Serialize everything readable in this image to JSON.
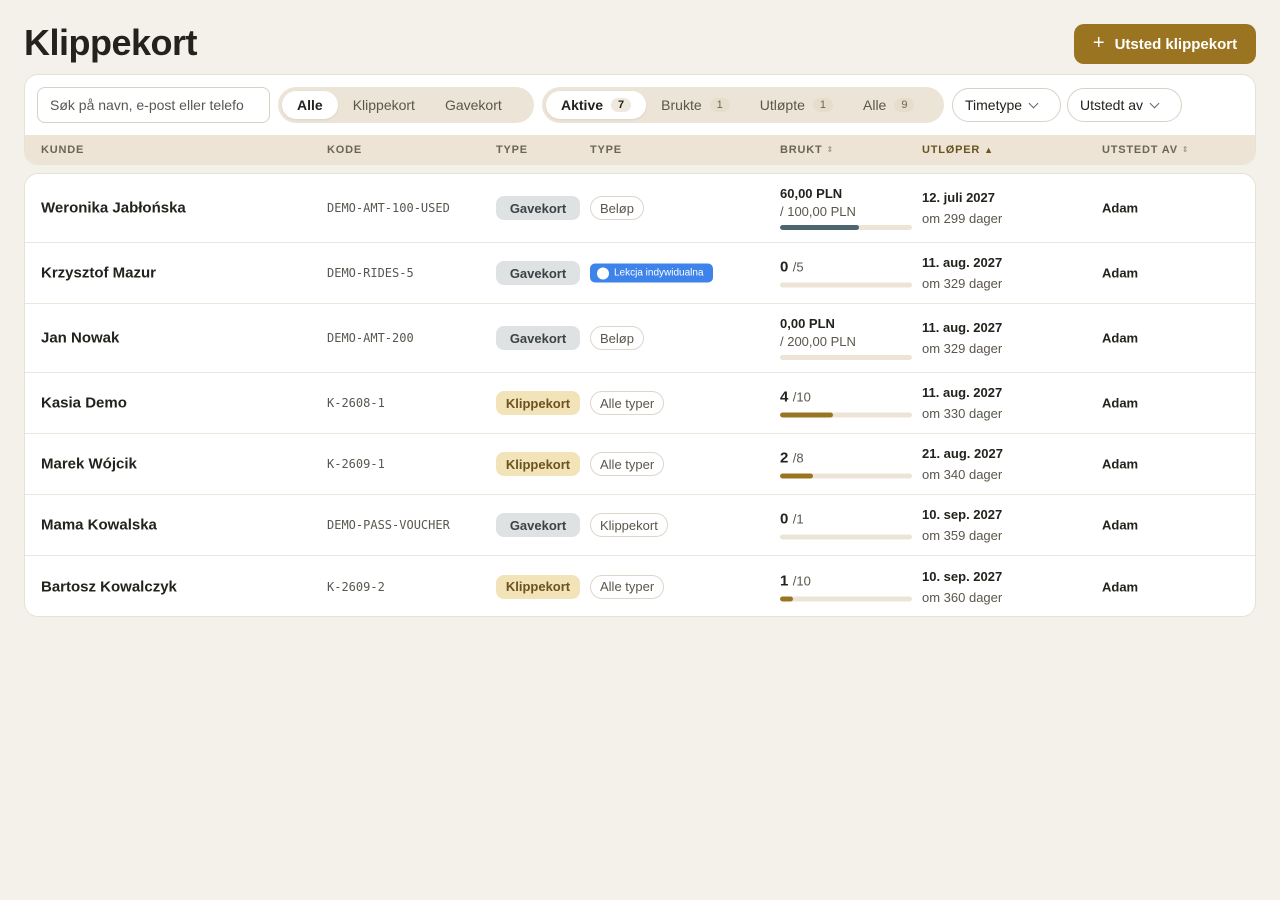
{
  "page": {
    "title": "Klippekort"
  },
  "toolbar": {
    "issue_button_label": "Utsted klippekort",
    "issue_button_icon": "plus-icon"
  },
  "filters": {
    "search_placeholder": "Søk på navn, e-post eller telefo",
    "type_segments": [
      "Alle",
      "Klippekort",
      "Gavekort"
    ],
    "type_selected": "Alle",
    "status_segments": [
      {
        "label": "Aktive",
        "count": "7"
      },
      {
        "label": "Brukte",
        "count": "1"
      },
      {
        "label": "Utløpte",
        "count": "1"
      },
      {
        "label": "Alle",
        "count": "9"
      }
    ],
    "status_selected": "Aktive",
    "dropdown_timetype": "Timetype",
    "dropdown_issuer": "Utstedt av"
  },
  "table": {
    "headers": {
      "customer": "KUNDE",
      "code": "KODE",
      "type": "TYPE",
      "type2": "TYPE",
      "used": "BRUKT",
      "expires": "UTLØPER",
      "issued_by": "UTSTEDT AV"
    },
    "sorted_column": "expires",
    "sort_direction": "ascending",
    "rows": [
      {
        "name": "Weronika Jabłońska",
        "code": "DEMO-AMT-100-USED",
        "type": "Gavekort",
        "subtype": "Beløp",
        "used_main": "60,00 PLN",
        "used_total": "/ 100,00 PLN",
        "used_fraction": 0.6,
        "expires": "12. juli 2027",
        "relative": "om 299 dager",
        "issued_by": "Adam"
      },
      {
        "name": "Krzysztof Mazur",
        "code": "DEMO-RIDES-5",
        "type": "Gavekort",
        "subtype": "Lekcja indywidualna",
        "used_main": "0",
        "used_total": "/5",
        "used_fraction": 0.0,
        "expires": "11. aug. 2027",
        "relative": "om 329 dager",
        "issued_by": "Adam"
      },
      {
        "name": "Jan Nowak",
        "code": "DEMO-AMT-200",
        "type": "Gavekort",
        "subtype": "Beløp",
        "used_main": "0,00 PLN",
        "used_total": "/ 200,00 PLN",
        "used_fraction": 0.0,
        "expires": "11. aug. 2027",
        "relative": "om 329 dager",
        "issued_by": "Adam"
      },
      {
        "name": "Kasia Demo",
        "code": "K-2608-1",
        "type": "Klippekort",
        "subtype": "Alle typer",
        "used_main": "4",
        "used_total": "/10",
        "used_fraction": 0.4,
        "expires": "11. aug. 2027",
        "relative": "om 330 dager",
        "issued_by": "Adam"
      },
      {
        "name": "Marek Wójcik",
        "code": "K-2609-1",
        "type": "Klippekort",
        "subtype": "Alle typer",
        "used_main": "2",
        "used_total": "/8",
        "used_fraction": 0.25,
        "expires": "21. aug. 2027",
        "relative": "om 340 dager",
        "issued_by": "Adam"
      },
      {
        "name": "Mama Kowalska",
        "code": "DEMO-PASS-VOUCHER",
        "type": "Gavekort",
        "subtype": "Klippekort",
        "used_main": "0",
        "used_total": "/1",
        "used_fraction": 0.0,
        "expires": "10. sep. 2027",
        "relative": "om 359 dager",
        "issued_by": "Adam"
      },
      {
        "name": "Bartosz Kowalczyk",
        "code": "K-2609-2",
        "type": "Klippekort",
        "subtype": "Alle typer",
        "used_main": "1",
        "used_total": "/10",
        "used_fraction": 0.1,
        "expires": "10. sep. 2027",
        "relative": "om 360 dager",
        "issued_by": "Adam"
      }
    ]
  },
  "colors": {
    "accent": "#9a7420",
    "gift_bar": "#4d666d",
    "punch_bar": "#9a7420",
    "lesson_chip": "#3e83ea"
  }
}
